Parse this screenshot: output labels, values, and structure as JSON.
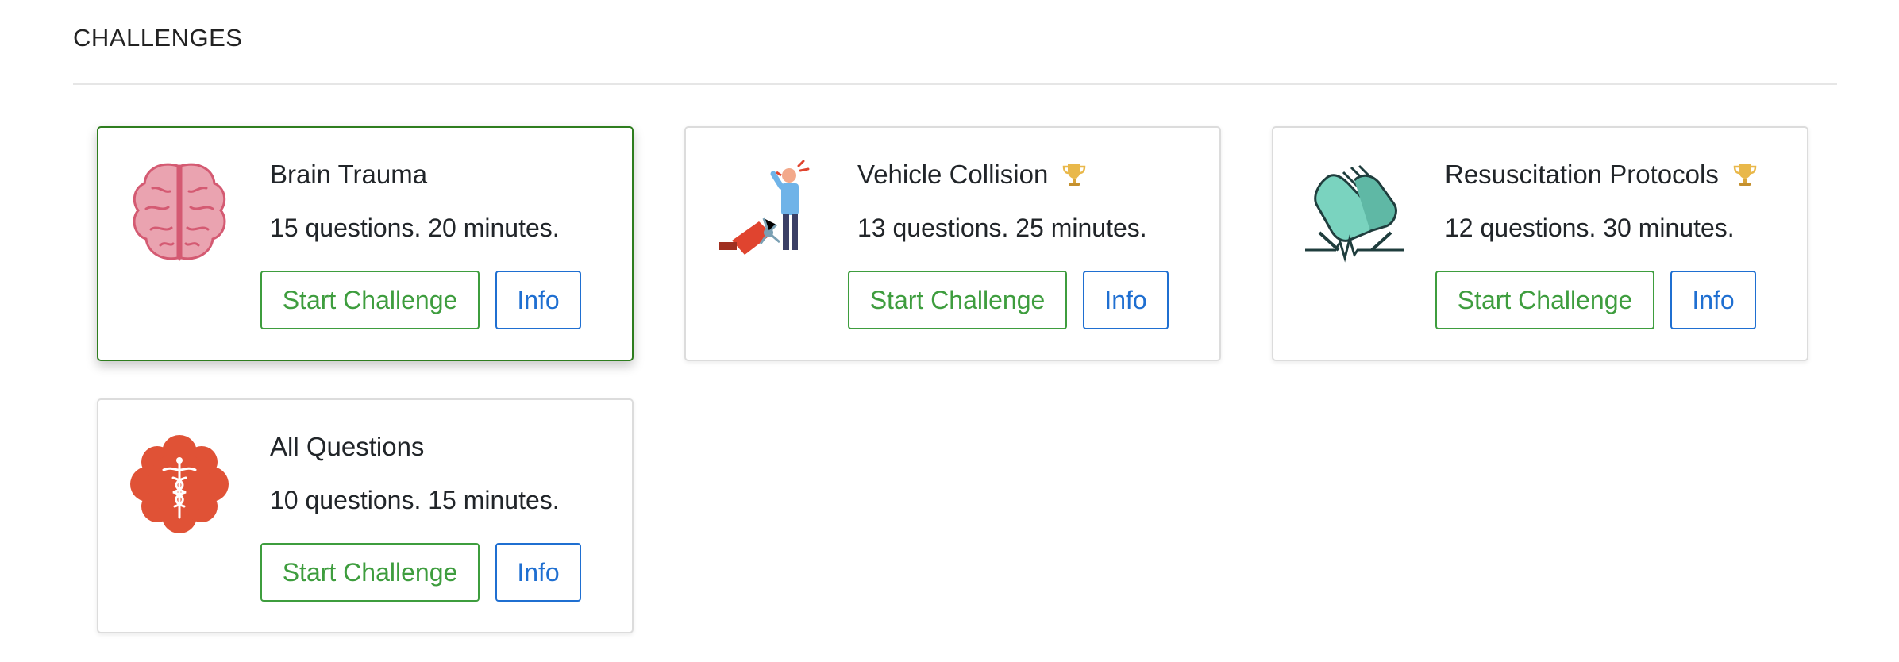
{
  "section": {
    "title": "CHALLENGES"
  },
  "colors": {
    "start_button": "#3e9d3e",
    "info_button": "#1f6fd1",
    "selected_border": "#2e7d1e",
    "trophy": "#e9b84a"
  },
  "challenges": [
    {
      "title": "Brain Trauma",
      "description": "15 questions. 20 minutes.",
      "icon": "brain-icon",
      "has_trophy": false,
      "selected": true,
      "start_label": "Start Challenge",
      "info_label": "Info"
    },
    {
      "title": "Vehicle Collision",
      "description": "13 questions. 25 minutes.",
      "icon": "vehicle-collision-icon",
      "has_trophy": true,
      "selected": false,
      "start_label": "Start Challenge",
      "info_label": "Info"
    },
    {
      "title": "Resuscitation Protocols",
      "description": "12 questions. 30 minutes.",
      "icon": "resuscitation-hands-icon",
      "has_trophy": true,
      "selected": false,
      "start_label": "Start Challenge",
      "info_label": "Info"
    },
    {
      "title": "All Questions",
      "description": "10 questions. 15 minutes.",
      "icon": "medical-caduceus-icon",
      "has_trophy": false,
      "selected": false,
      "start_label": "Start Challenge",
      "info_label": "Info"
    }
  ]
}
